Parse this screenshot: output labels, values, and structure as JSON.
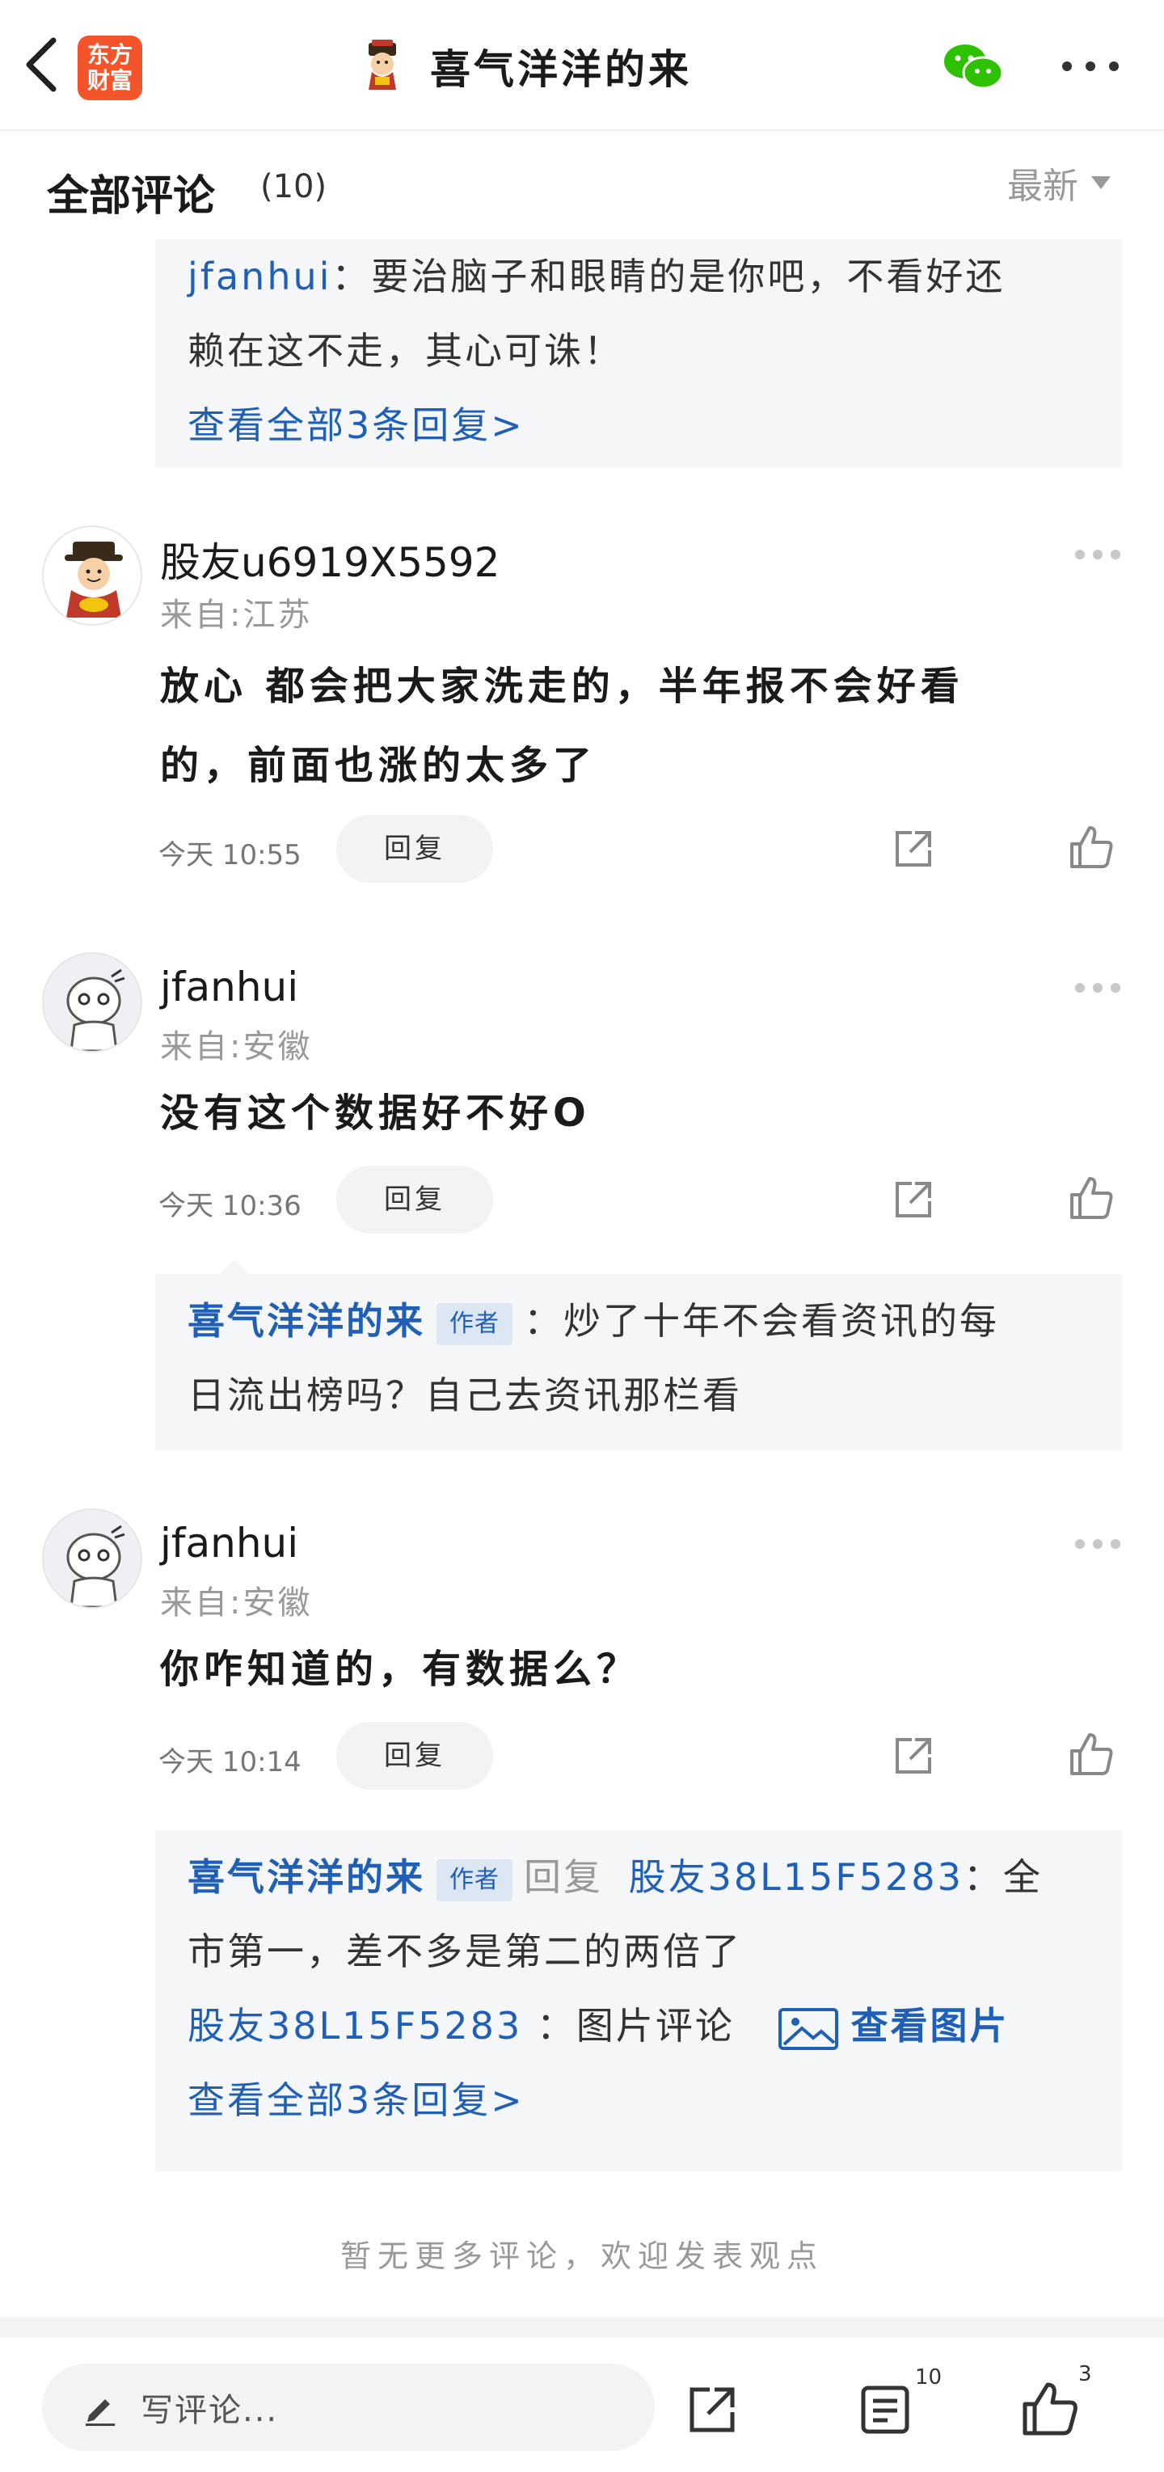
{
  "header": {
    "logo_line1": "东方",
    "logo_line2": "财富",
    "title": "喜气洋洋的来"
  },
  "section": {
    "title": "全部评论",
    "count": "(10)",
    "sort_label": "最新"
  },
  "top_reply": {
    "user": "jfanhui",
    "text_line1": "：要治脑子和眼睛的是你吧，不看好还",
    "text_line2": "赖在这不走，其心可诛！",
    "view_all": "查看全部3条回复>"
  },
  "comments": [
    {
      "user": "股友u6919X5592",
      "location": "来自:江苏",
      "text_line1": "放心 都会把大家洗走的，半年报不会好看",
      "text_line2": "的，前面也涨的太多了",
      "time": "今天  10:55",
      "reply_label": "回复"
    },
    {
      "user": "jfanhui",
      "location": "来自:安徽",
      "text_line1": "没有这个数据好不好O",
      "time": "今天  10:36",
      "reply_label": "回复",
      "reply": {
        "user": "喜气洋洋的来",
        "tag": "作者",
        "text_line1": "：炒了十年不会看资讯的每",
        "text_line2": "日流出榜吗？自己去资讯那栏看"
      }
    },
    {
      "user": "jfanhui",
      "location": "来自:安徽",
      "text_line1": "你咋知道的，有数据么？",
      "time": "今天  10:14",
      "reply_label": "回复",
      "reply": {
        "user": "喜气洋洋的来",
        "tag": "作者",
        "reply_word": "回复",
        "target": "股友38L15F5283",
        "text_line1_tail": "：全",
        "text_line2": "市第一，差不多是第二的两倍了",
        "sub_user": "股友38L15F5283",
        "sub_text": "：图片评论",
        "view_pic": "查看图片",
        "view_all": "查看全部3条回复>"
      }
    }
  ],
  "no_more": "暂无更多评论，欢迎发表观点",
  "bottom_bar": {
    "input_placeholder": "写评论...",
    "comment_count": "10",
    "like_count": "3"
  },
  "colors": {
    "brand": "#f3542a",
    "link": "#1f5fb6",
    "reply_bg": "#f5f6f8"
  }
}
